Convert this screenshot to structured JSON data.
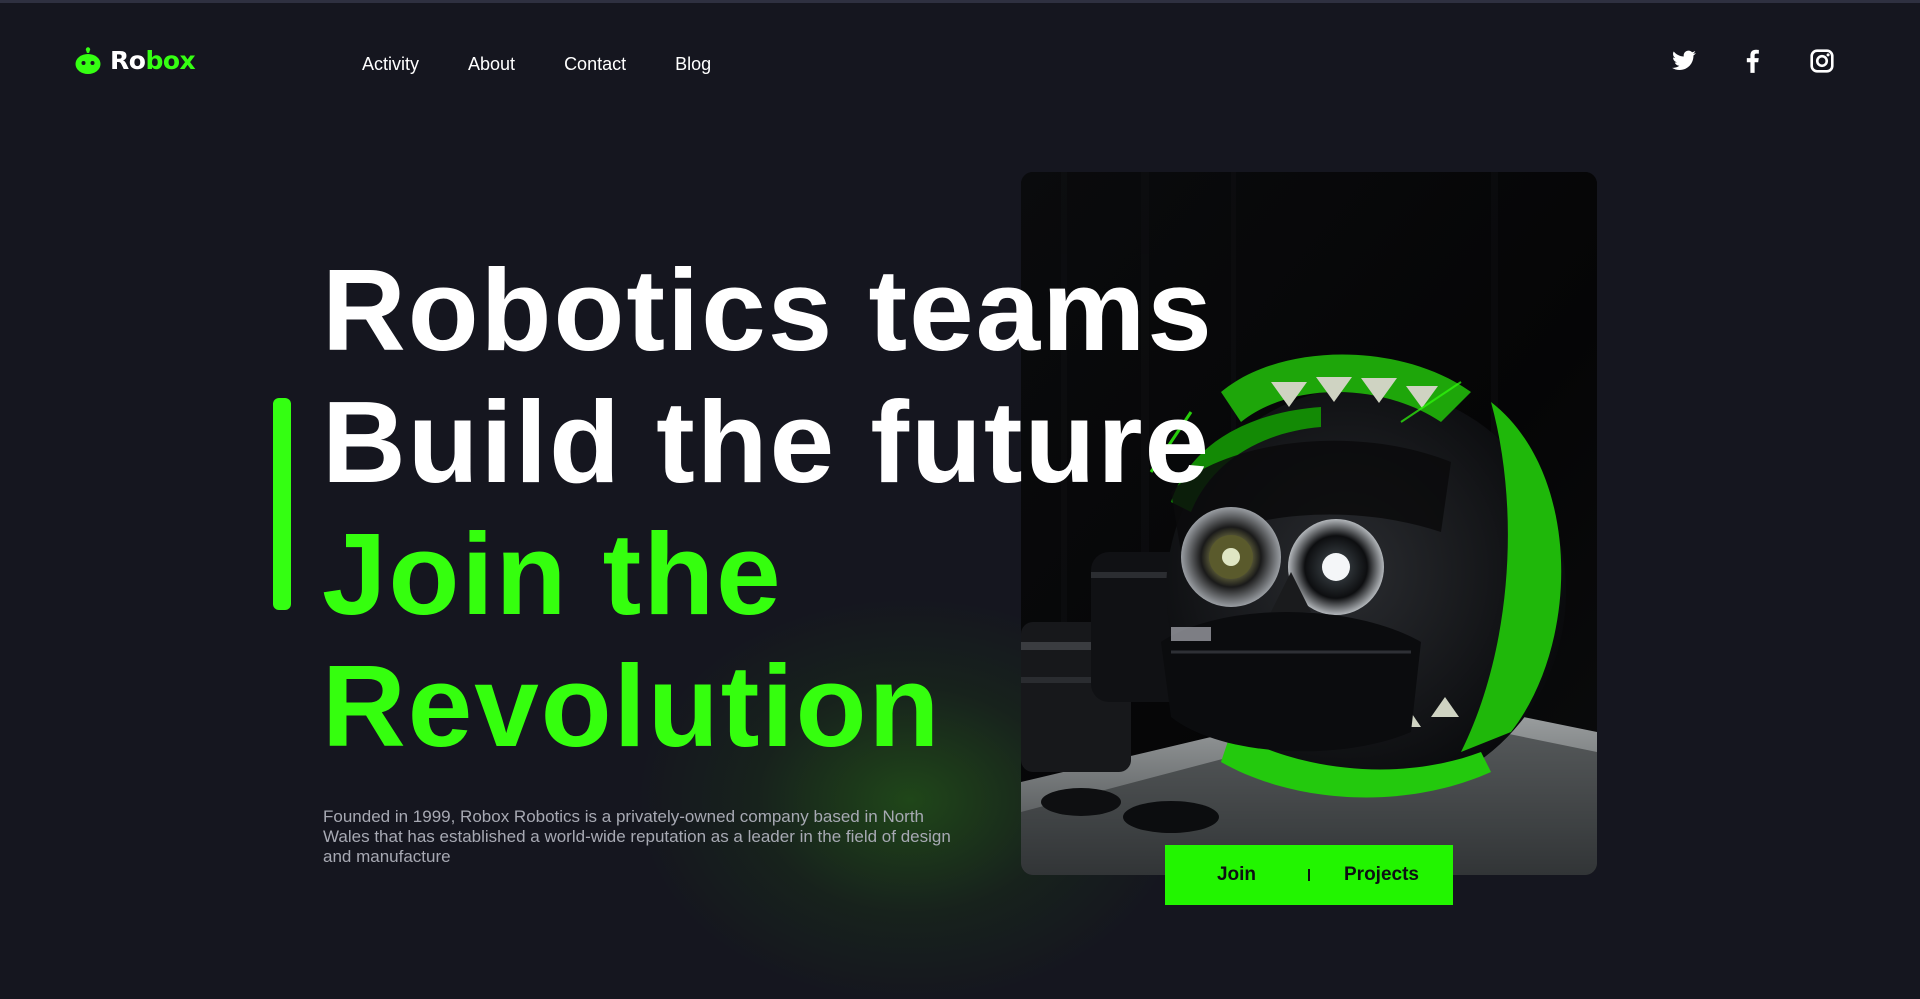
{
  "brand": {
    "name_part1": "Ro",
    "name_part2": "box",
    "accent_color": "#35ff12",
    "background_color": "#15161f"
  },
  "nav": {
    "items": [
      "Activity",
      "About",
      "Contact",
      "Blog"
    ]
  },
  "social": {
    "icons": [
      "twitter-icon",
      "facebook-icon",
      "instagram-icon"
    ]
  },
  "hero": {
    "line1": "Robotics teams",
    "line2": "Build the future",
    "line3": "Join the",
    "line4": "Revolution",
    "description": "Founded in 1999, Robox Robotics is a privately-owned company based in North Wales that has established a world-wide reputation as a leader in the field of design and manufacture"
  },
  "cta": {
    "join_label": "Join",
    "projects_label": "Projects"
  }
}
